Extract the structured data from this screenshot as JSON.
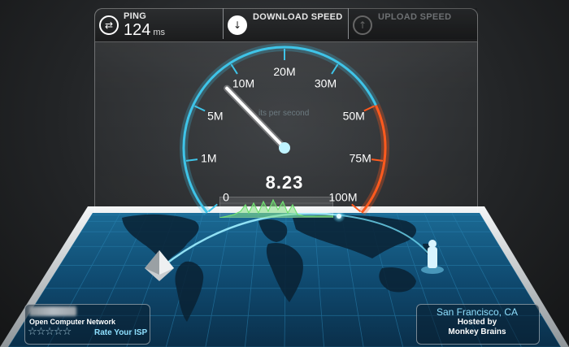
{
  "header": {
    "ping_label": "PING",
    "ping_value": "124",
    "ping_unit": "ms",
    "download_label": "DOWNLOAD SPEED",
    "upload_label": "UPLOAD SPEED",
    "ping_icon": "swap-arrows-icon",
    "download_icon": "arrow-down-icon",
    "upload_icon": "arrow-up-icon"
  },
  "gauge": {
    "ticks": [
      "0",
      "1M",
      "5M",
      "10M",
      "20M",
      "30M",
      "50M",
      "75M",
      "100M"
    ],
    "caption": "its per second",
    "reading": "8.23",
    "needle_value": 8.23,
    "accent_color": "#3fc4e8",
    "danger_color": "#ff5a1e"
  },
  "isp": {
    "name": "Open Computer Network",
    "rating_stars": 5,
    "rate_label": "Rate Your ISP"
  },
  "server": {
    "city": "San Francisco, CA",
    "hosted_line1": "Hosted by",
    "hosted_line2": "Monkey Brains"
  }
}
